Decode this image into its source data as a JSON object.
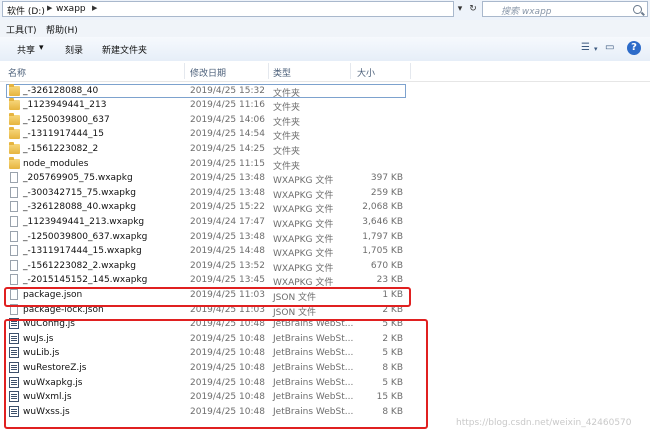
{
  "address": {
    "crumbs": [
      "软件 (D:)",
      "wxapp"
    ],
    "arrow": "▶",
    "search_placeholder": "搜索 wxapp",
    "refresh_glyph": "↻",
    "dropdown_glyph": "▾"
  },
  "menu": {
    "tools": "工具(T)",
    "help": "帮助(H)"
  },
  "toolbar": {
    "share": "共享",
    "share_arrow": "▾",
    "burn": "刻录",
    "new_folder": "新建文件夹",
    "help_glyph": "?"
  },
  "columns": {
    "name": "名称",
    "date": "修改日期",
    "type": "类型",
    "size": "大小"
  },
  "files": [
    {
      "icon": "folder",
      "name": "_-326128088_40",
      "date": "2019/4/25 15:32",
      "type": "文件夹",
      "size": ""
    },
    {
      "icon": "folder",
      "name": "_1123949441_213",
      "date": "2019/4/25 11:16",
      "type": "文件夹",
      "size": ""
    },
    {
      "icon": "folder",
      "name": "_-1250039800_637",
      "date": "2019/4/25 14:06",
      "type": "文件夹",
      "size": ""
    },
    {
      "icon": "folder",
      "name": "_-1311917444_15",
      "date": "2019/4/25 14:54",
      "type": "文件夹",
      "size": ""
    },
    {
      "icon": "folder",
      "name": "_-1561223082_2",
      "date": "2019/4/25 14:25",
      "type": "文件夹",
      "size": ""
    },
    {
      "icon": "folder",
      "name": "node_modules",
      "date": "2019/4/25 11:15",
      "type": "文件夹",
      "size": ""
    },
    {
      "icon": "doc",
      "name": "_205769905_75.wxapkg",
      "date": "2019/4/25 13:48",
      "type": "WXAPKG 文件",
      "size": "397 KB"
    },
    {
      "icon": "doc",
      "name": "_-300342715_75.wxapkg",
      "date": "2019/4/25 13:48",
      "type": "WXAPKG 文件",
      "size": "259 KB"
    },
    {
      "icon": "doc",
      "name": "_-326128088_40.wxapkg",
      "date": "2019/4/25 15:22",
      "type": "WXAPKG 文件",
      "size": "2,068 KB"
    },
    {
      "icon": "doc",
      "name": "_1123949441_213.wxapkg",
      "date": "2019/4/24 17:47",
      "type": "WXAPKG 文件",
      "size": "3,646 KB"
    },
    {
      "icon": "doc",
      "name": "_-1250039800_637.wxapkg",
      "date": "2019/4/25 13:48",
      "type": "WXAPKG 文件",
      "size": "1,797 KB"
    },
    {
      "icon": "doc",
      "name": "_-1311917444_15.wxapkg",
      "date": "2019/4/25 14:48",
      "type": "WXAPKG 文件",
      "size": "1,705 KB"
    },
    {
      "icon": "doc",
      "name": "_-1561223082_2.wxapkg",
      "date": "2019/4/25 13:52",
      "type": "WXAPKG 文件",
      "size": "670 KB"
    },
    {
      "icon": "doc",
      "name": "_-2015145152_145.wxapkg",
      "date": "2019/4/25 13:45",
      "type": "WXAPKG 文件",
      "size": "23 KB"
    },
    {
      "icon": "doc",
      "name": "package.json",
      "date": "2019/4/25 11:03",
      "type": "JSON 文件",
      "size": "1 KB"
    },
    {
      "icon": "doc",
      "name": "package-lock.json",
      "date": "2019/4/25 11:03",
      "type": "JSON 文件",
      "size": "2 KB"
    },
    {
      "icon": "js",
      "name": "wuConfig.js",
      "date": "2019/4/25 10:48",
      "type": "JetBrains WebSt...",
      "size": "5 KB"
    },
    {
      "icon": "js",
      "name": "wuJs.js",
      "date": "2019/4/25 10:48",
      "type": "JetBrains WebSt...",
      "size": "2 KB"
    },
    {
      "icon": "js",
      "name": "wuLib.js",
      "date": "2019/4/25 10:48",
      "type": "JetBrains WebSt...",
      "size": "5 KB"
    },
    {
      "icon": "js",
      "name": "wuRestoreZ.js",
      "date": "2019/4/25 10:48",
      "type": "JetBrains WebSt...",
      "size": "8 KB"
    },
    {
      "icon": "js",
      "name": "wuWxapkg.js",
      "date": "2019/4/25 10:48",
      "type": "JetBrains WebSt...",
      "size": "5 KB"
    },
    {
      "icon": "js",
      "name": "wuWxml.js",
      "date": "2019/4/25 10:48",
      "type": "JetBrains WebSt...",
      "size": "15 KB"
    },
    {
      "icon": "js",
      "name": "wuWxss.js",
      "date": "2019/4/25 10:48",
      "type": "JetBrains WebSt...",
      "size": "8 KB"
    }
  ],
  "watermark": "https://blog.csdn.net/weixin_42460570"
}
